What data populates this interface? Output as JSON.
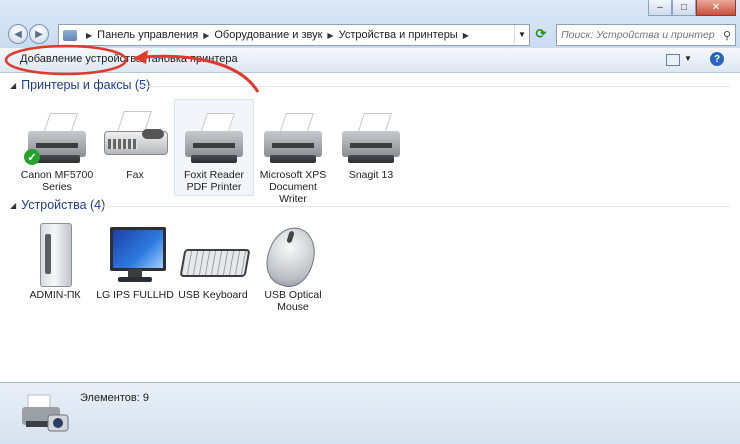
{
  "breadcrumb": {
    "items": [
      "Панель управления",
      "Оборудование и звук",
      "Устройства и принтеры"
    ]
  },
  "search": {
    "placeholder": "Поиск: Устройства и принтеры"
  },
  "toolbar": {
    "add_device": "Добавление устройства",
    "add_printer": "Установка принтера"
  },
  "groups": {
    "printers": {
      "title": "Принтеры и факсы (5)",
      "items": [
        {
          "label": "Canon MF5700 Series",
          "icon": "printer-icon",
          "default": true
        },
        {
          "label": "Fax",
          "icon": "fax-icon"
        },
        {
          "label": "Foxit Reader PDF Printer",
          "icon": "printer-icon",
          "selected": true
        },
        {
          "label": "Microsoft XPS Document Writer",
          "icon": "printer-icon"
        },
        {
          "label": "Snagit 13",
          "icon": "printer-icon"
        }
      ]
    },
    "devices": {
      "title": "Устройства (4)",
      "items": [
        {
          "label": "ADMIN-ПК",
          "icon": "computer-icon"
        },
        {
          "label": "LG IPS FULLHD",
          "icon": "monitor-icon"
        },
        {
          "label": "USB Keyboard",
          "icon": "keyboard-icon"
        },
        {
          "label": "USB Optical Mouse",
          "icon": "mouse-icon"
        }
      ]
    }
  },
  "status": {
    "count_text": "Элементов: 9"
  },
  "colors": {
    "annotation": "#e03a2f",
    "group_title": "#1e3c8c",
    "accent": "#2b64b8"
  }
}
